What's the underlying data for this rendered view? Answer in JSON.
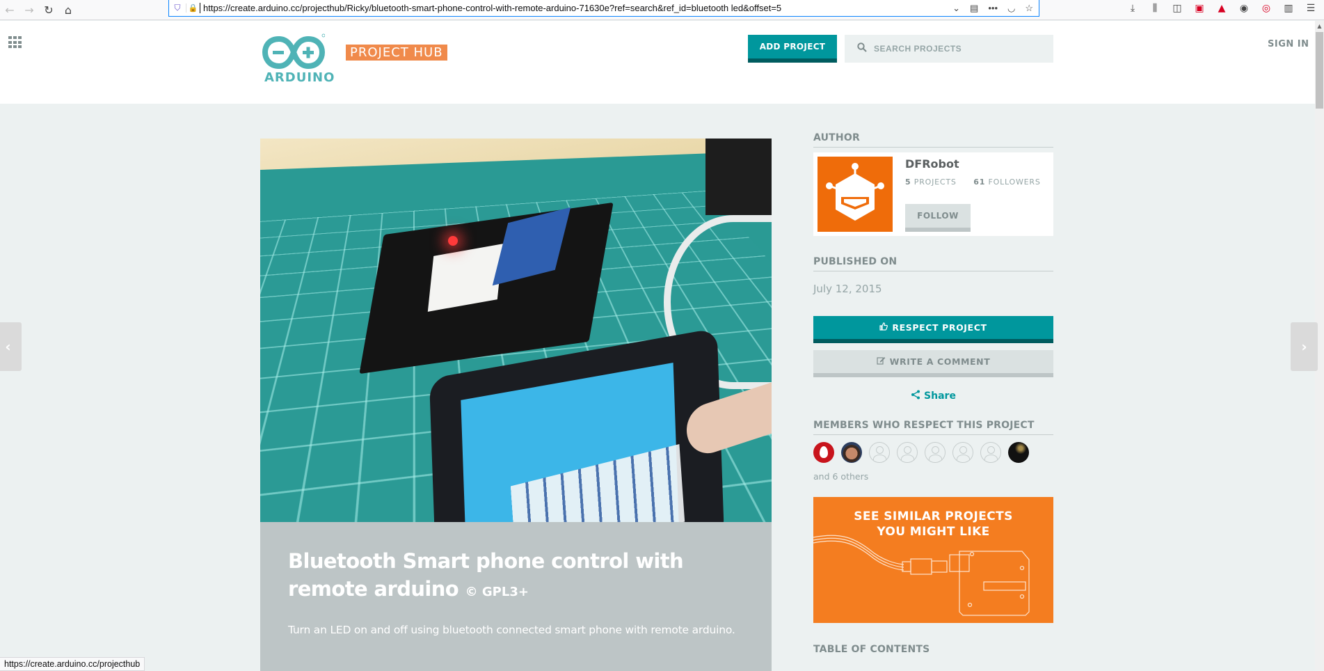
{
  "browser": {
    "url": "https://create.arduino.cc/projecthub/Ricky/bluetooth-smart-phone-control-with-remote-arduino-71630e?ref=search&ref_id=bluetooth led&offset=5",
    "status_url": "https://create.arduino.cc/projecthub",
    "icons": {
      "back": "←",
      "forward": "→",
      "reload": "↻",
      "home": "⌂",
      "shield": "⛉",
      "lock": "🔒",
      "dropdown": "⌄",
      "reader": "▤",
      "more": "•••",
      "pocket": "◡",
      "bookmark": "☆",
      "downloads": "⤓",
      "library": "⫼",
      "sidebar": "◫",
      "ext1": "▣",
      "pdf": "▲",
      "account": "◉",
      "ext2": "◎",
      "ext3": "▥",
      "menu": "☰"
    }
  },
  "header": {
    "logo_word": "ARDUINO",
    "logo_hub": "PROJECT HUB",
    "add_project": "ADD PROJECT",
    "search_placeholder": "SEARCH PROJECTS",
    "sign_in": "SIGN IN"
  },
  "project": {
    "title": "Bluetooth Smart phone control with remote arduino",
    "license": "© GPL3+",
    "description": "Turn an LED on and off using bluetooth connected smart phone with remote arduino."
  },
  "sidebar": {
    "author_heading": "AUTHOR",
    "author": {
      "name": "DFRobot",
      "projects_count": "5",
      "projects_label": "PROJECTS",
      "followers_count": "61",
      "followers_label": "FOLLOWERS",
      "follow": "FOLLOW"
    },
    "published_heading": "PUBLISHED ON",
    "published_date": "July 12, 2015",
    "respect": "RESPECT PROJECT",
    "comment": "WRITE A COMMENT",
    "share": "Share",
    "members_heading": "MEMBERS WHO RESPECT THIS PROJECT",
    "members": [
      "fire-logo",
      "photo",
      "default",
      "default",
      "default",
      "default",
      "default",
      "dark-photo"
    ],
    "others": "and 6 others",
    "similar_line1": "SEE SIMILAR PROJECTS",
    "similar_line2": "YOU MIGHT LIKE",
    "toc_heading": "TABLE OF CONTENTS"
  },
  "nav": {
    "prev": "‹",
    "next": "›"
  },
  "colors": {
    "teal": "#00979d",
    "teal_dark": "#005c5f",
    "orange": "#f47d20",
    "author_orange": "#ef6c0a",
    "bg": "#ecf1f1"
  }
}
